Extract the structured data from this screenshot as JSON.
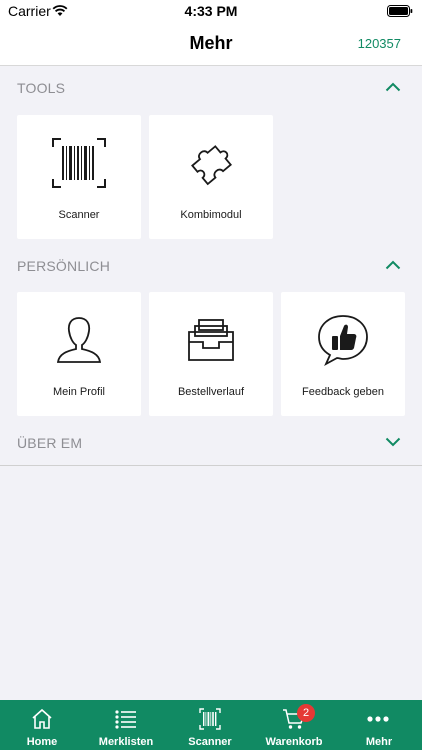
{
  "status_bar": {
    "carrier": "Carrier",
    "time": "4:33 PM"
  },
  "nav": {
    "title": "Mehr",
    "account_number": "120357"
  },
  "sections": [
    {
      "title": "TOOLS",
      "expanded": true,
      "tiles": [
        {
          "label": "Scanner",
          "icon": "barcode-scanner-icon"
        },
        {
          "label": "Kombimodul",
          "icon": "puzzle-icon"
        }
      ]
    },
    {
      "title": "PERSÖNLICH",
      "expanded": true,
      "tiles": [
        {
          "label": "Mein Profil",
          "icon": "user-profile-icon"
        },
        {
          "label": "Bestellverlauf",
          "icon": "order-tray-icon"
        },
        {
          "label": "Feedback geben",
          "icon": "thumbs-up-icon"
        }
      ]
    },
    {
      "title": "ÜBER EM",
      "expanded": false,
      "tiles": []
    }
  ],
  "tab_bar": {
    "items": [
      {
        "label": "Home",
        "icon": "home-icon"
      },
      {
        "label": "Merklisten",
        "icon": "list-icon"
      },
      {
        "label": "Scanner",
        "icon": "barcode-icon"
      },
      {
        "label": "Warenkorb",
        "icon": "cart-icon",
        "badge": "2"
      },
      {
        "label": "Mehr",
        "icon": "more-icon"
      }
    ]
  },
  "colors": {
    "accent": "#118a63",
    "badge": "#e53935",
    "background": "#f2f2f7"
  }
}
